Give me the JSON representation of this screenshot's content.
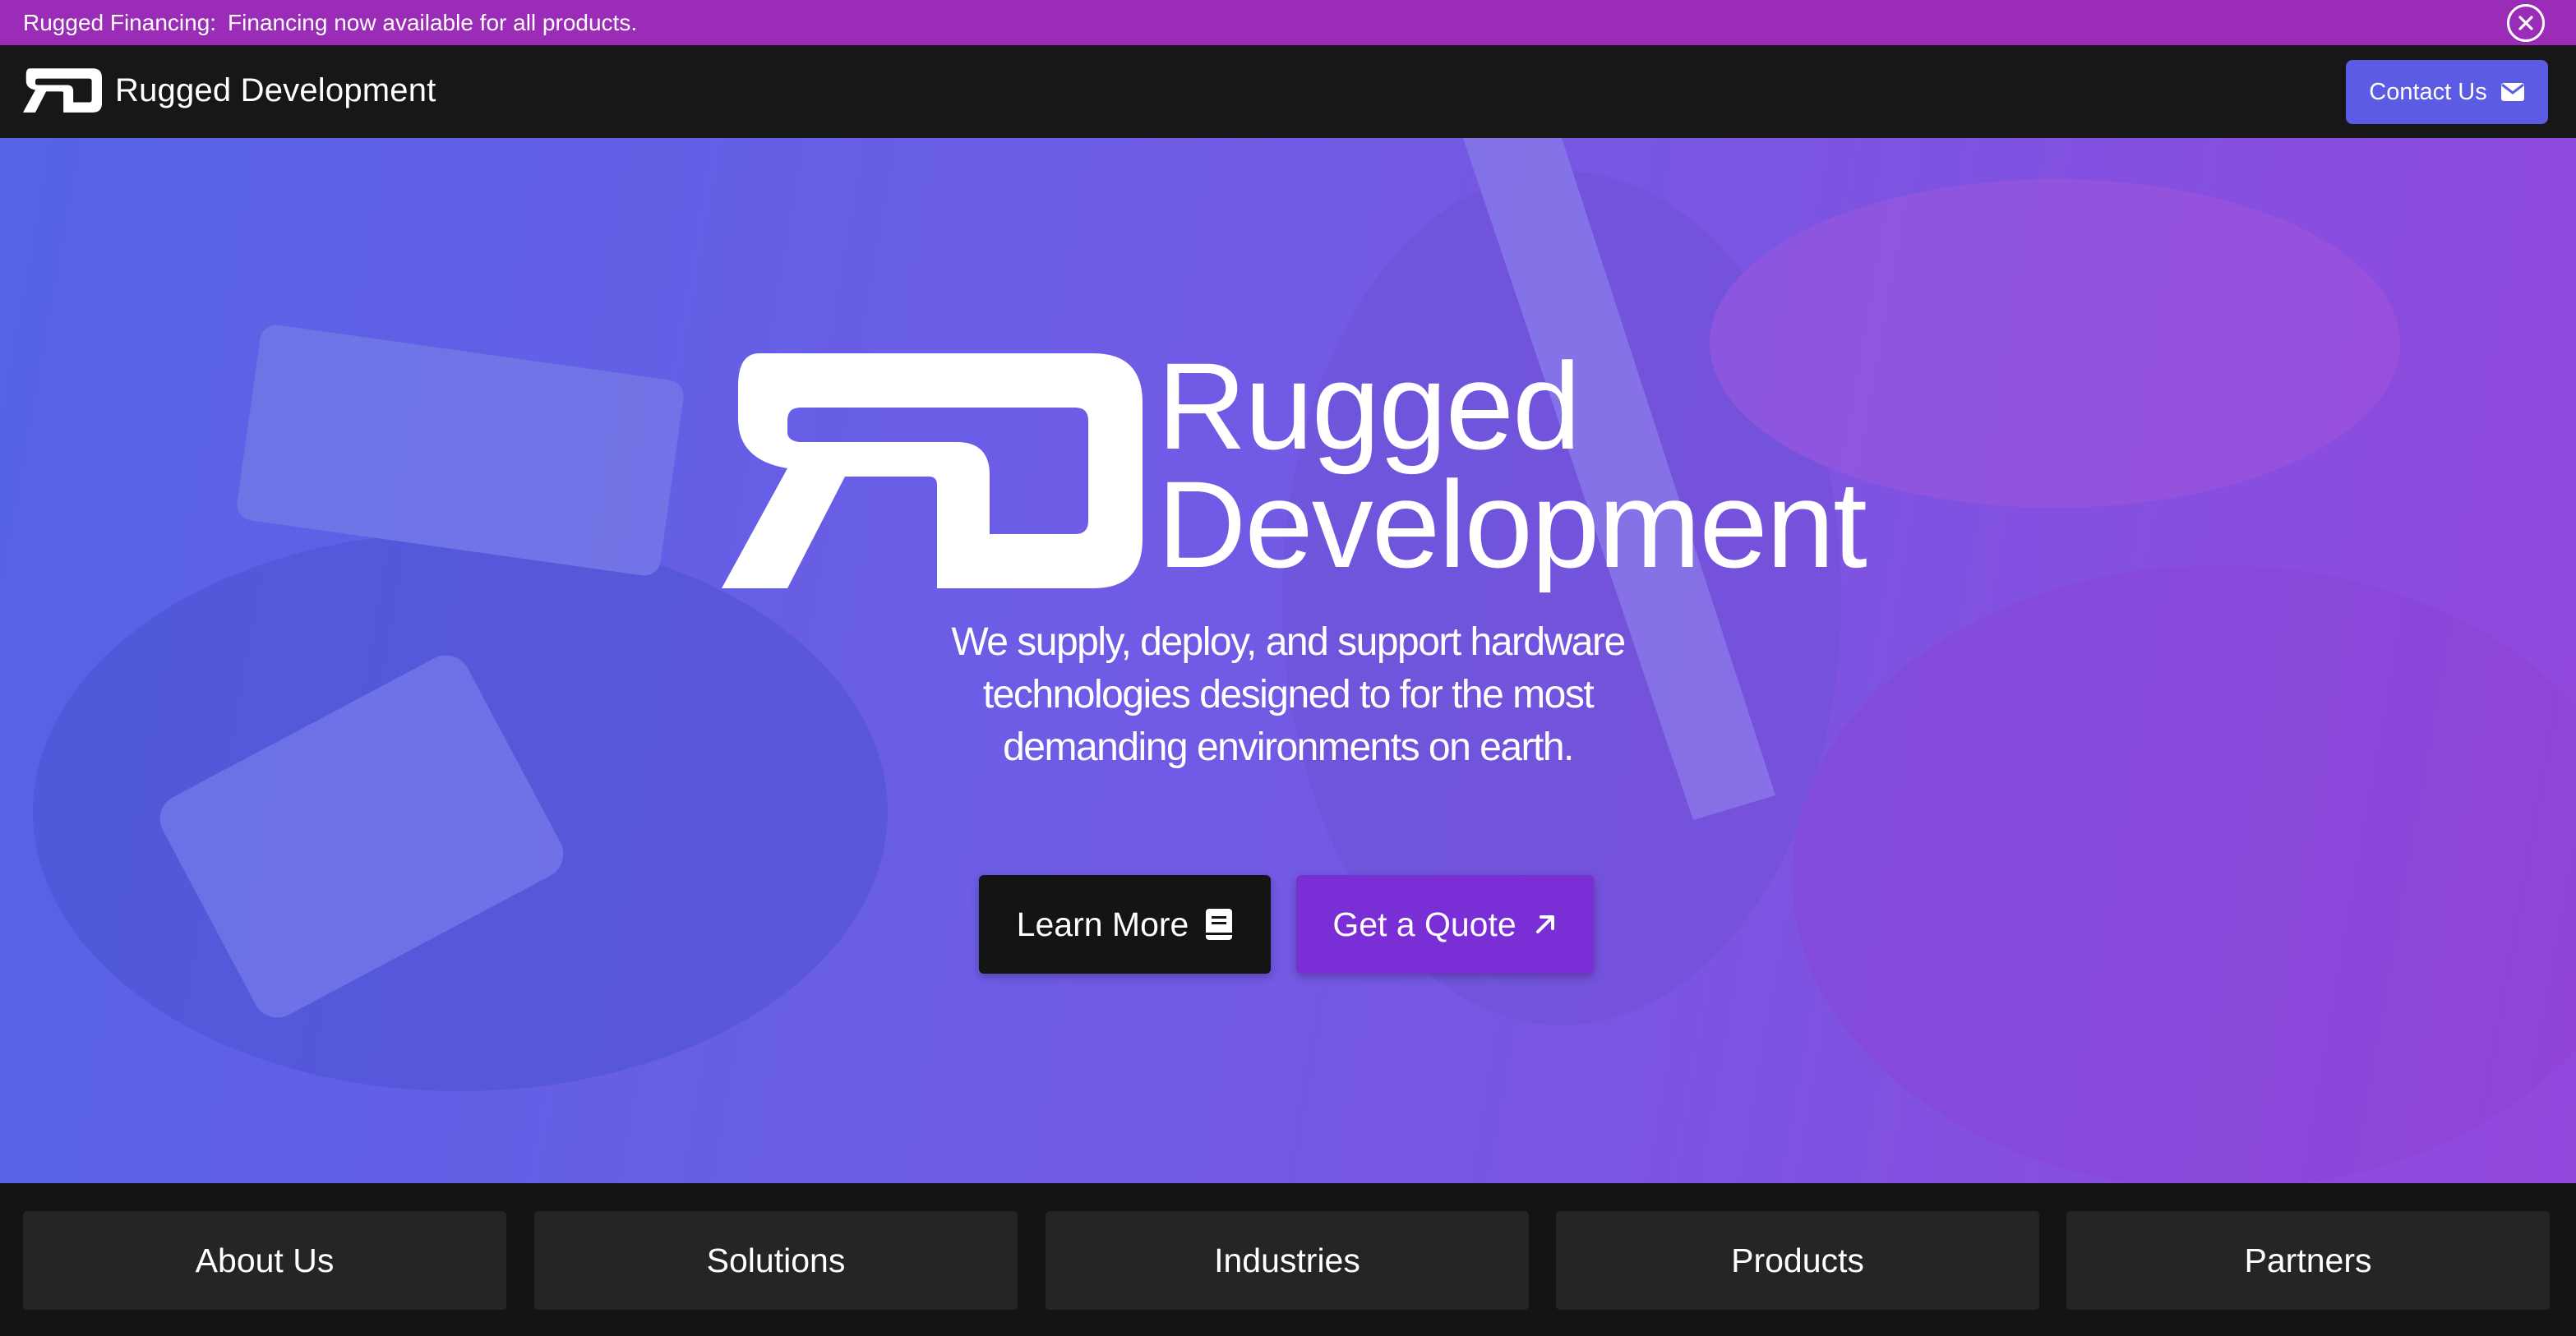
{
  "announcement": {
    "label": "Rugged Financing:",
    "message": "Financing now available for all products.",
    "close_icon": "close-circle-icon",
    "background": "#9a2cb8"
  },
  "navbar": {
    "brand_name": "Rugged Development",
    "logo_icon": "rd-logo-icon",
    "contact_label": "Contact Us",
    "contact_icon": "envelope-icon",
    "contact_color": "#5b5be3"
  },
  "hero": {
    "title_line1": "Rugged",
    "title_line2": "Development",
    "subtitle_line1": "We supply, deploy, and support hardware",
    "subtitle_line2": "technologies designed to for the most",
    "subtitle_line3": "demanding environments on earth.",
    "learn_more_label": "Learn More",
    "learn_more_icon": "book-icon",
    "quote_label": "Get a Quote",
    "quote_icon": "arrow-up-right-icon",
    "quote_color": "#7a2ed6"
  },
  "bottom_nav": {
    "items": [
      {
        "label": "About Us"
      },
      {
        "label": "Solutions"
      },
      {
        "label": "Industries"
      },
      {
        "label": "Products"
      },
      {
        "label": "Partners"
      }
    ]
  }
}
